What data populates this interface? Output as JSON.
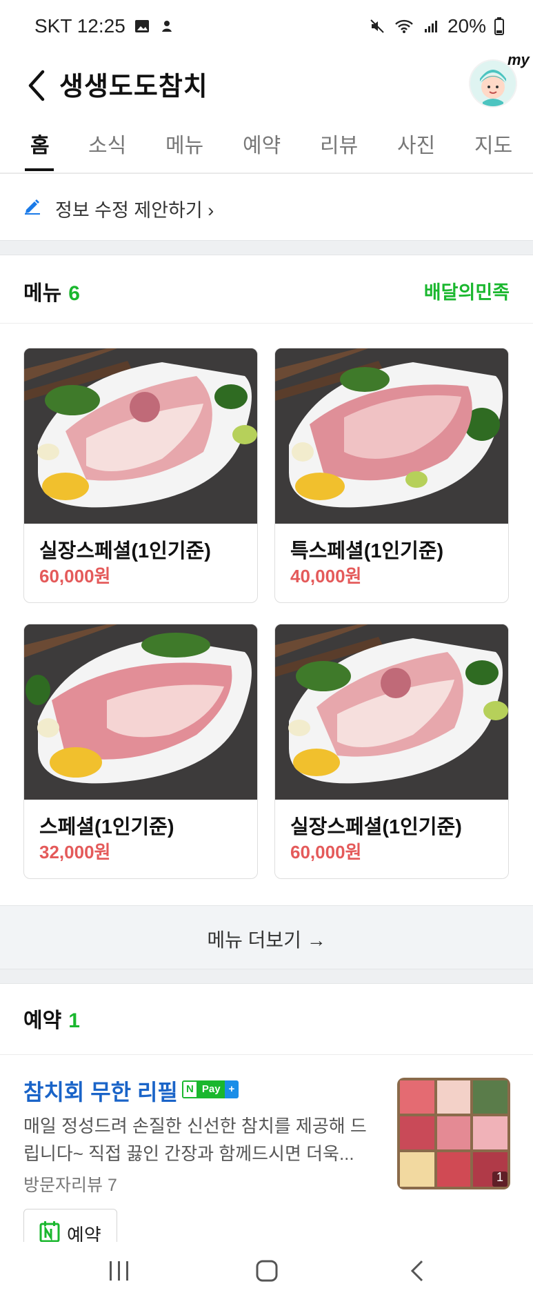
{
  "status_bar": {
    "carrier_time": "SKT 12:25",
    "battery": "20%"
  },
  "header": {
    "title": "생생도도참치",
    "avatar_badge": "my"
  },
  "tabs": [
    {
      "label": "홈",
      "active": true
    },
    {
      "label": "소식",
      "active": false
    },
    {
      "label": "메뉴",
      "active": false
    },
    {
      "label": "예약",
      "active": false
    },
    {
      "label": "리뷰",
      "active": false
    },
    {
      "label": "사진",
      "active": false
    },
    {
      "label": "지도",
      "active": false
    }
  ],
  "info_edit": {
    "label": "정보 수정 제안하기"
  },
  "menu_section": {
    "title": "메뉴",
    "count": "6",
    "link": "배달의민족",
    "items": [
      {
        "name": "실장스페셜(1인기준)",
        "price": "60,000원"
      },
      {
        "name": "특스페셜(1인기준)",
        "price": "40,000원"
      },
      {
        "name": "스페셜(1인기준)",
        "price": "32,000원"
      },
      {
        "name": "실장스페셜(1인기준)",
        "price": "60,000원"
      }
    ],
    "more_label": "메뉴 더보기"
  },
  "reservation_section": {
    "title": "예약",
    "count": "1",
    "item": {
      "title": "참치회 무한 리필",
      "pay_badge_n": "N",
      "pay_badge_text": "Pay",
      "description": "매일 정성드려 손질한 신선한 참치를 제공해 드립니다~ 직접 끓인 간장과 함께드시면 더욱...",
      "review": "방문자리뷰 7",
      "thumb_count": "1",
      "button_label": "예약"
    }
  },
  "colors": {
    "accent_green": "#1ab72e",
    "price_red": "#e45a5a",
    "link_blue": "#1a64c8"
  }
}
